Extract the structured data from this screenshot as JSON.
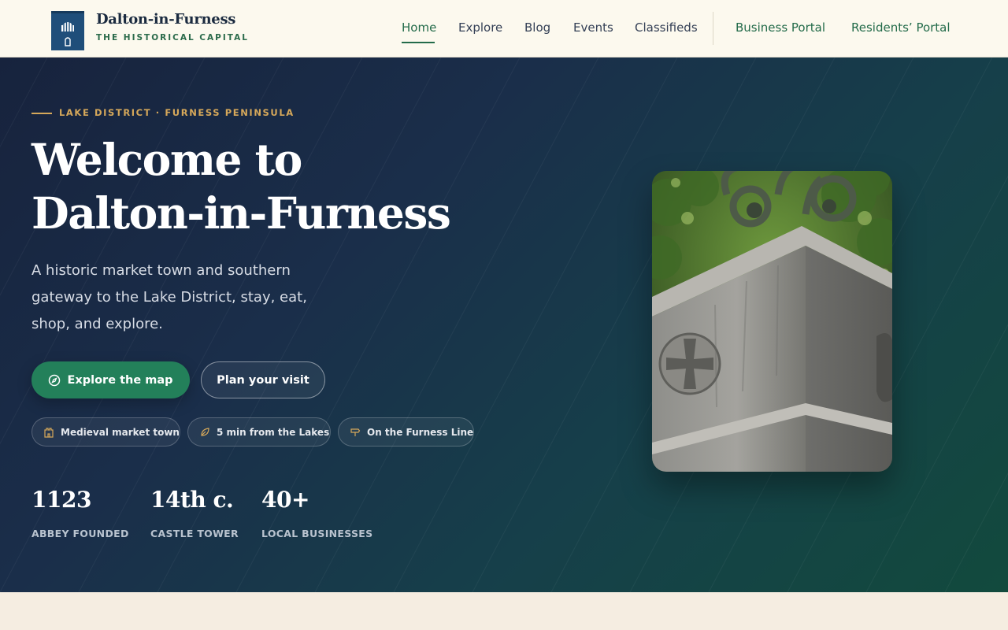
{
  "brand": {
    "name": "Dalton-in-Furness",
    "tagline": "THE HISTORICAL CAPITAL"
  },
  "nav": {
    "items": [
      {
        "label": "Home",
        "active": true
      },
      {
        "label": "Explore"
      },
      {
        "label": "Blog"
      },
      {
        "label": "Events"
      },
      {
        "label": "Classifieds"
      }
    ],
    "portals": [
      {
        "label": "Business Portal"
      },
      {
        "label": "Residents’ Portal"
      }
    ]
  },
  "hero": {
    "kicker": "LAKE DISTRICT · FURNESS PENINSULA",
    "title_line1": "Welcome to",
    "title_line2": "Dalton-in-Furness",
    "subtitle": "A historic market town and southern gateway to the Lake District, stay, eat, shop, and explore.",
    "primary_button": "Explore the map",
    "secondary_button": "Plan your visit",
    "chips": [
      {
        "label": "Medieval market town",
        "icon": "castle-icon"
      },
      {
        "label": "5 min from the Lakes",
        "icon": "leaf-icon"
      },
      {
        "label": "On the Furness Line",
        "icon": "signpost-icon"
      }
    ],
    "stats": [
      {
        "value": "1123",
        "label": "ABBEY FOUNDED"
      },
      {
        "value": "14th c.",
        "label": "CASTLE TOWER"
      },
      {
        "value": "40+",
        "label": "LOCAL BUSINESSES"
      }
    ]
  },
  "colors": {
    "accent_green": "#23805a",
    "kicker_gold": "#d6a85a",
    "header_bg": "#fcf9ee",
    "hero_navy": "#17233d"
  }
}
